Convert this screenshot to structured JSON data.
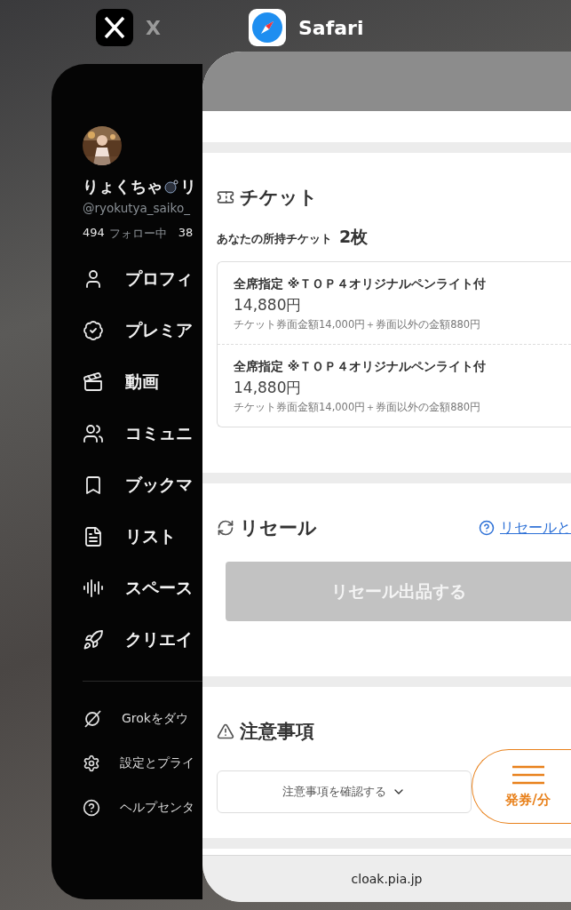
{
  "switcher_labels": [
    {
      "kind": "x",
      "label": "X"
    },
    {
      "kind": "safari",
      "label": "Safari"
    }
  ],
  "x_app": {
    "name": "りょくちゃ",
    "name_rest": "リ",
    "handle": "@ryokutya_saiko_",
    "following_count": "494",
    "following_label": "フォロー中",
    "followers_count": "38",
    "menu": [
      {
        "kind": "person",
        "label": "プロフィ"
      },
      {
        "kind": "badge",
        "label": "プレミア"
      },
      {
        "kind": "video",
        "label": "動画"
      },
      {
        "kind": "people",
        "label": "コミュニ"
      },
      {
        "kind": "bookmark",
        "label": "ブックマ"
      },
      {
        "kind": "list",
        "label": "リスト"
      },
      {
        "kind": "spaces",
        "label": "スペース"
      },
      {
        "kind": "rocket",
        "label": "クリエイ"
      }
    ],
    "footer": [
      {
        "kind": "grok",
        "label": "Grokをダウ"
      },
      {
        "kind": "settings",
        "label": "設定とプライ"
      },
      {
        "kind": "help",
        "label": "ヘルプセンタ"
      }
    ]
  },
  "safari_page": {
    "ticket": {
      "title": "チケット",
      "owned_label": "あなたの所持チケット",
      "owned_count": "2枚",
      "items": [
        {
          "name": "全席指定 ※ＴＯＰ４オリジナルペンライト付",
          "price": "14,880円",
          "breakdown": "チケット券面金額14,000円＋券面以外の金額880円"
        },
        {
          "name": "全席指定 ※ＴＯＰ４オリジナルペンライト付",
          "price": "14,880円",
          "breakdown": "チケット券面金額14,000円＋券面以外の金額880円"
        }
      ]
    },
    "resale": {
      "title": "リセール",
      "help_link": "リセールと",
      "button": "リセール出品する",
      "disabled": true
    },
    "notes": {
      "title": "注意事項",
      "toggle": "注意事項を確認する"
    },
    "fab": "発券/分",
    "url": "cloak.pia.jp"
  }
}
